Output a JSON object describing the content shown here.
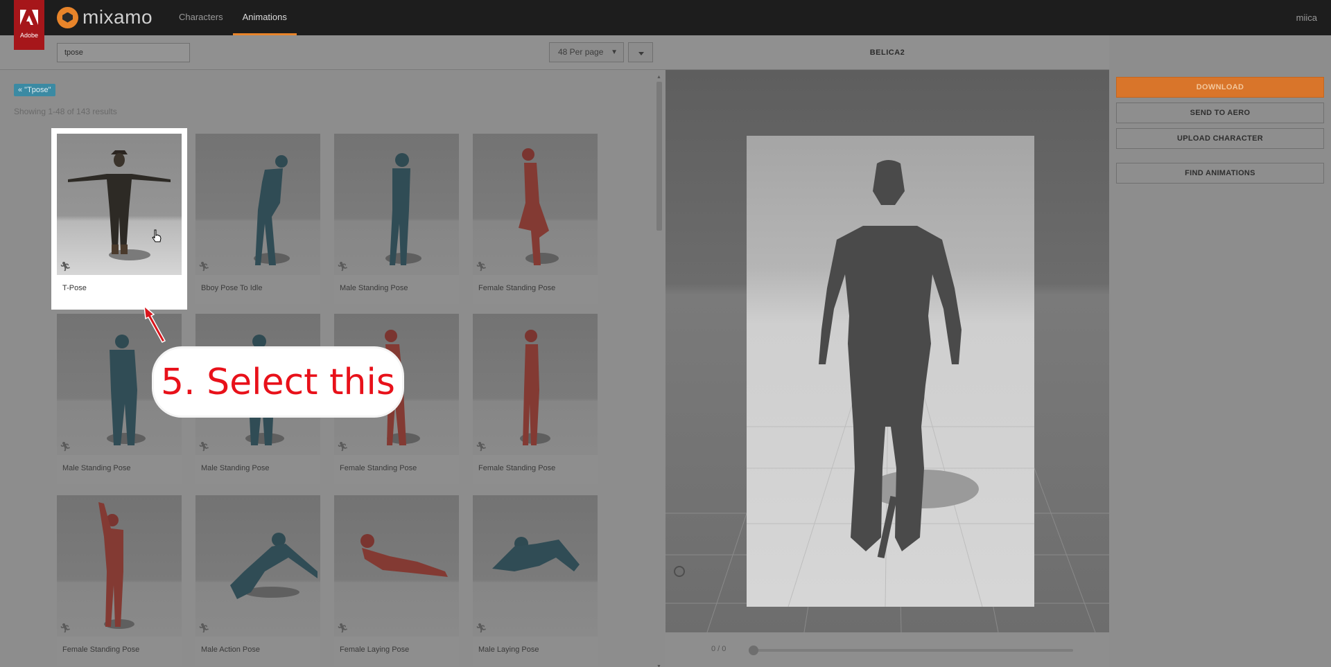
{
  "header": {
    "adobe_label": "Adobe",
    "logo_text": "mixamo",
    "nav": [
      {
        "label": "Characters",
        "active": false
      },
      {
        "label": "Animations",
        "active": true
      }
    ],
    "user": "miica",
    "accent_color": "#e8842a"
  },
  "search": {
    "value": "tpose",
    "per_page": "48 Per page"
  },
  "filter_tag": "« \"Tpose\"",
  "results_text": "Showing 1-48 of 143 results",
  "cards": [
    {
      "label": "T-Pose",
      "selected": true
    },
    {
      "label": "Bboy Pose To Idle"
    },
    {
      "label": "Male Standing Pose"
    },
    {
      "label": "Female Standing Pose"
    },
    {
      "label": "Male Standing Pose"
    },
    {
      "label": "Male Standing Pose"
    },
    {
      "label": "Female Standing Pose"
    },
    {
      "label": "Female Standing Pose"
    },
    {
      "label": "Female Standing Pose"
    },
    {
      "label": "Male Action Pose"
    },
    {
      "label": "Female Laying Pose"
    },
    {
      "label": "Male Laying Pose"
    }
  ],
  "callout": "5. Select this",
  "viewer": {
    "title": "BELICA2",
    "frame": "0 / 0"
  },
  "actions": {
    "download": "DOWNLOAD",
    "send_to_aero": "SEND TO AERO",
    "upload_character": "UPLOAD CHARACTER",
    "find_animations": "FIND ANIMATIONS"
  }
}
